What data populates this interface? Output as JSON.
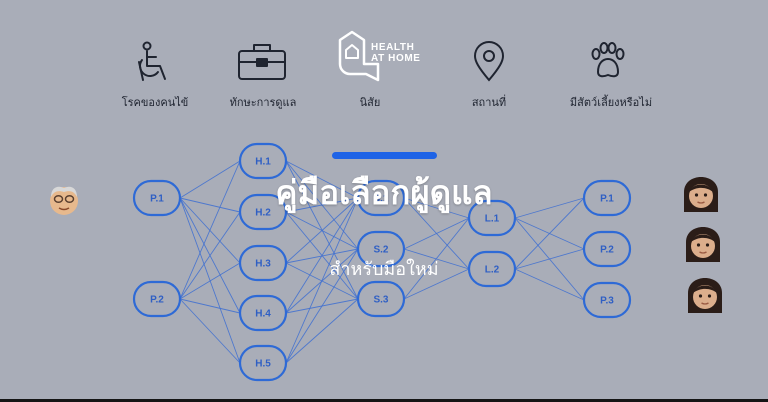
{
  "colors": {
    "background": "#a9adb8",
    "node_stroke": "#2e6ad6",
    "edge": "#3f6fd1",
    "accent": "#1e63e6",
    "icon": "#1f2430"
  },
  "brand": {
    "line1": "HEALTH",
    "line2": "AT HOME",
    "logo_icon": "house-heart-logo-icon"
  },
  "categories": [
    {
      "icon": "wheelchair-icon",
      "label": "โรคของคนไข้"
    },
    {
      "icon": "briefcase-icon",
      "label": "ทักษะการดูแล"
    },
    {
      "icon": "speech-bubble-icon",
      "label": "นิสัย"
    },
    {
      "icon": "location-pin-icon",
      "label": "สถานที่"
    },
    {
      "icon": "paw-icon",
      "label": "มีสัตว์เลี้ยงหรือไม่"
    }
  ],
  "headline": "คู่มือเลือกผู้ดูแล",
  "subtitle": "สำหรับมือใหม่",
  "network": {
    "left_nodes": [
      "P.1",
      "P.2"
    ],
    "h_nodes": [
      "H.1",
      "H.2",
      "H.3",
      "H.4",
      "H.5"
    ],
    "s_nodes": [
      "S.1",
      "S.2",
      "S.3"
    ],
    "l_nodes": [
      "L.1",
      "L.2"
    ],
    "right_nodes": [
      "P.1",
      "P.2",
      "P.3"
    ]
  },
  "avatars": {
    "patient": "elderly-man-avatar-icon",
    "caregivers": [
      "woman-avatar-icon",
      "woman-avatar-icon",
      "woman-avatar-icon"
    ]
  }
}
